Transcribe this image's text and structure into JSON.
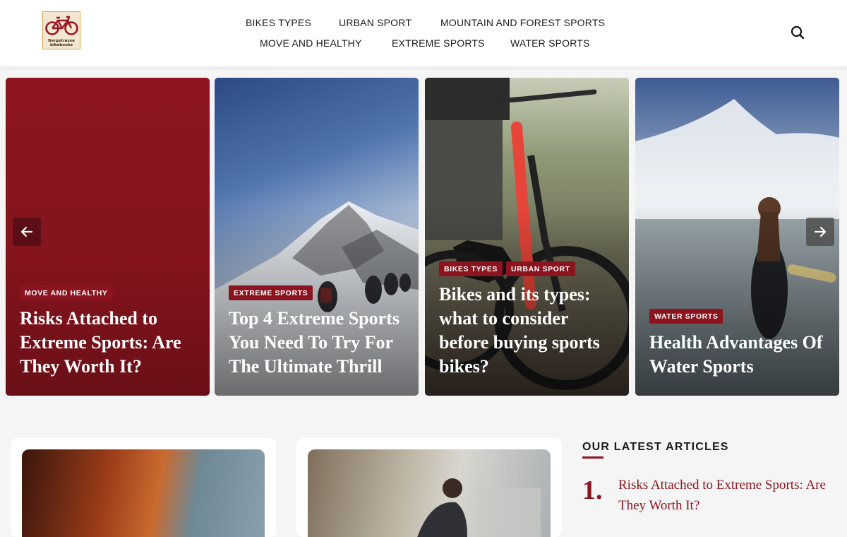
{
  "header": {
    "logo_text": "Bergstrasse bikebooks",
    "nav_row1": [
      "BIKES TYPES",
      "URBAN SPORT",
      "MOUNTAIN AND FOREST SPORTS"
    ],
    "nav_row2": [
      "MOVE AND HEALTHY",
      "EXTREME SPORTS",
      "WATER SPORTS"
    ]
  },
  "slider": {
    "cards": [
      {
        "tags": [
          "MOVE AND HEALTHY"
        ],
        "title": "Risks Attached to Extreme Sports: Are They Worth It?"
      },
      {
        "tags": [
          "EXTREME SPORTS"
        ],
        "title": "Top 4 Extreme Sports You Need To Try For The Ultimate Thrill"
      },
      {
        "tags": [
          "BIKES TYPES",
          "URBAN SPORT"
        ],
        "title": "Bikes and its types: what to consider before buying sports bikes?"
      },
      {
        "tags": [
          "WATER SPORTS"
        ],
        "title": "Health Advantages Of Water Sports"
      }
    ]
  },
  "latest": {
    "heading": "OUR LATEST ARTICLES",
    "items": [
      {
        "number": "1.",
        "title": "Risks Attached to Extreme Sports: Are They Worth It?"
      }
    ]
  },
  "colors": {
    "accent": "#8b141f",
    "header_bg": "#ffffff",
    "page_bg": "#f5f5f5"
  },
  "icons": {
    "search": "search-icon",
    "prev": "arrow-left-icon",
    "next": "arrow-right-icon"
  }
}
